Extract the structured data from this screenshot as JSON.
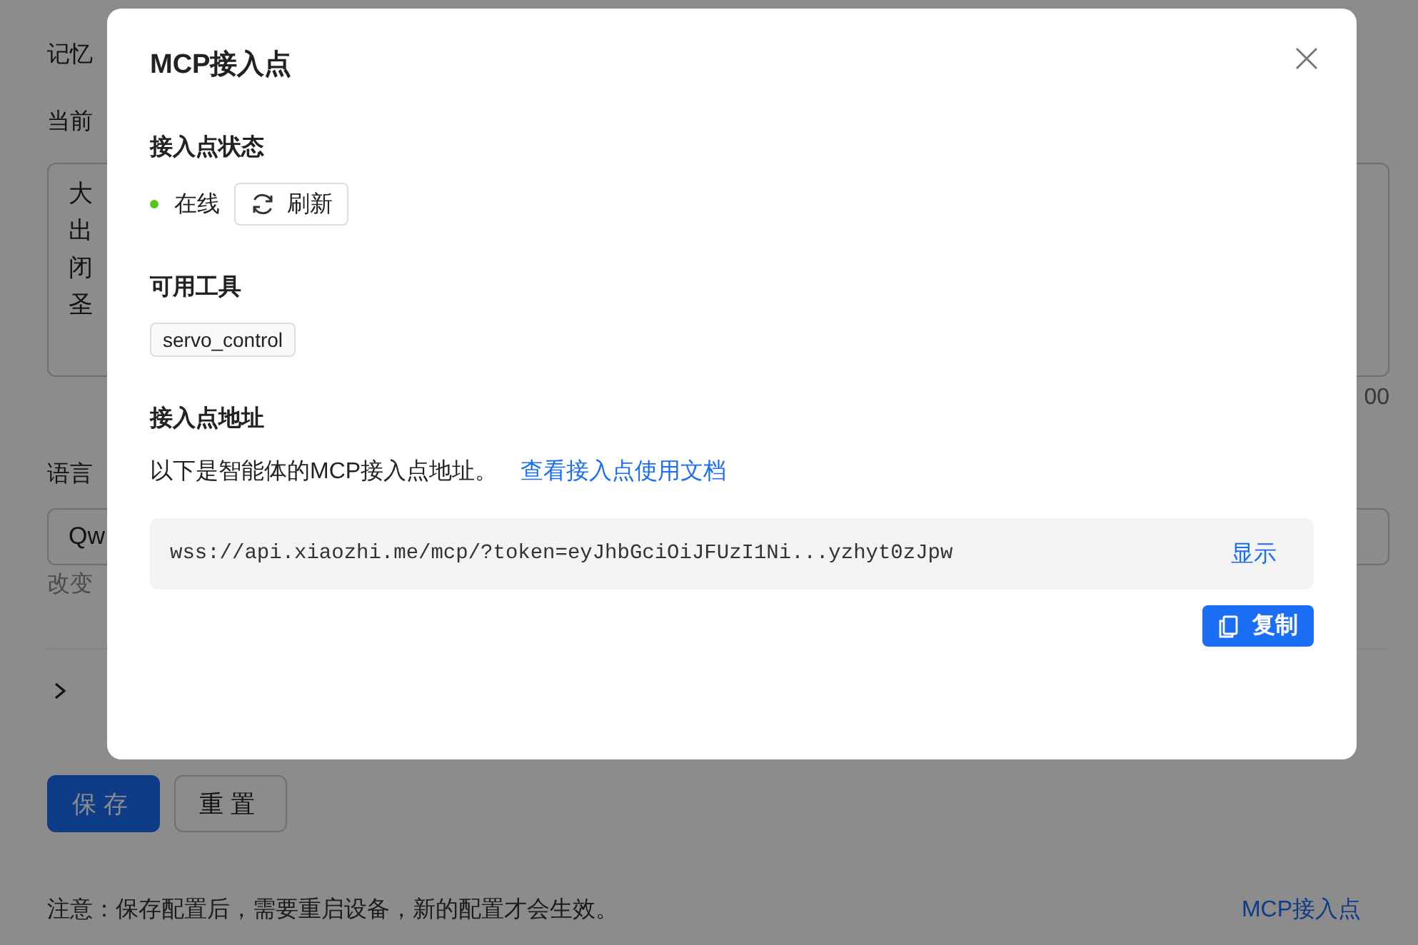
{
  "background": {
    "memory_label": "记忆",
    "current_label": "当前",
    "textarea_lines": [
      "大",
      "出",
      "闭",
      "圣"
    ],
    "char_count": "00",
    "language_label": "语言",
    "model_select_value": "Qw",
    "hint": "改变",
    "advanced_expanded": false,
    "buttons": [
      "保存",
      "重置"
    ],
    "note": "注意：保存配置后，需要重启设备，新的配置才会生效。",
    "mcp_link": "MCP接入点"
  },
  "dialog": {
    "title": "MCP接入点",
    "status_heading": "接入点状态",
    "status": {
      "text": "在线",
      "color": "#52c41a"
    },
    "refresh_button": "刷新",
    "tools_heading": "可用工具",
    "tools": [
      "servo_control"
    ],
    "address_heading": "接入点地址",
    "address_description": "以下是智能体的MCP接入点地址。",
    "docs_link": "查看接入点使用文档",
    "address": "wss://api.xiaozhi.me/mcp/?token=eyJhbGciOiJFUzI1Ni...yzhyt0zJpw",
    "show_button": "显示",
    "copy_button": "复制"
  }
}
